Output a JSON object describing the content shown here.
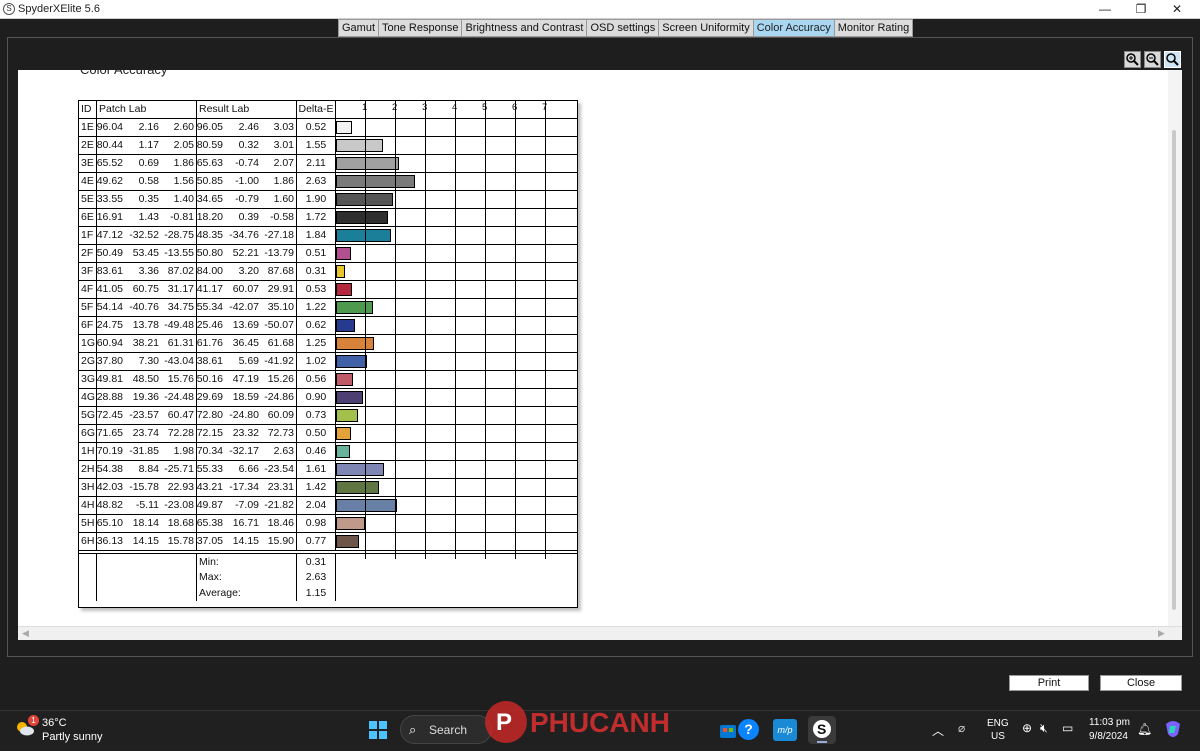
{
  "app": {
    "title": "SpyderXElite 5.6",
    "icon": "spyder-logo-icon",
    "window_controls": {
      "minimize": "—",
      "restore": "❐",
      "close": "✕"
    }
  },
  "tabs": [
    {
      "label": "Gamut",
      "active": false
    },
    {
      "label": "Tone Response",
      "active": false
    },
    {
      "label": "Brightness and Contrast",
      "active": false
    },
    {
      "label": "OSD settings",
      "active": false
    },
    {
      "label": "Screen Uniformity",
      "active": false
    },
    {
      "label": "Color Accuracy",
      "active": true
    },
    {
      "label": "Monitor Rating",
      "active": false
    }
  ],
  "zoom": {
    "zoom_in": "zoom-in-icon",
    "zoom_out": "zoom-out-icon",
    "zoom_fit": "zoom-fit-icon"
  },
  "report": {
    "title": "Color Accuracy",
    "headers": {
      "id": "ID",
      "patch": "Patch Lab",
      "result": "Result Lab",
      "delta": "Delta-E"
    },
    "scale_ticks": [
      "1",
      "2",
      "3",
      "4",
      "5",
      "6",
      "7"
    ],
    "rows": [
      {
        "id": "1E",
        "patch": [
          "96.04",
          "2.16",
          "2.60"
        ],
        "result": [
          "96.05",
          "2.46",
          "3.03"
        ],
        "delta": "0.52",
        "color": "#f2f2f2"
      },
      {
        "id": "2E",
        "patch": [
          "80.44",
          "1.17",
          "2.05"
        ],
        "result": [
          "80.59",
          "0.32",
          "3.01"
        ],
        "delta": "1.55",
        "color": "#c8c8c8"
      },
      {
        "id": "3E",
        "patch": [
          "65.52",
          "0.69",
          "1.86"
        ],
        "result": [
          "65.63",
          "-0.74",
          "2.07"
        ],
        "delta": "2.11",
        "color": "#a0a0a0"
      },
      {
        "id": "4E",
        "patch": [
          "49.62",
          "0.58",
          "1.56"
        ],
        "result": [
          "50.85",
          "-1.00",
          "1.86"
        ],
        "delta": "2.63",
        "color": "#7a7a7a"
      },
      {
        "id": "5E",
        "patch": [
          "33.55",
          "0.35",
          "1.40"
        ],
        "result": [
          "34.65",
          "-0.79",
          "1.60"
        ],
        "delta": "1.90",
        "color": "#555555"
      },
      {
        "id": "6E",
        "patch": [
          "16.91",
          "1.43",
          "-0.81"
        ],
        "result": [
          "18.20",
          "0.39",
          "-0.58"
        ],
        "delta": "1.72",
        "color": "#2e2e2e"
      },
      {
        "id": "1F",
        "patch": [
          "47.12",
          "-32.52",
          "-28.75"
        ],
        "result": [
          "48.35",
          "-34.76",
          "-27.18"
        ],
        "delta": "1.84",
        "color": "#1b7f99"
      },
      {
        "id": "2F",
        "patch": [
          "50.49",
          "53.45",
          "-13.55"
        ],
        "result": [
          "50.80",
          "52.21",
          "-13.79"
        ],
        "delta": "0.51",
        "color": "#b0508f"
      },
      {
        "id": "3F",
        "patch": [
          "83.61",
          "3.36",
          "87.02"
        ],
        "result": [
          "84.00",
          "3.20",
          "87.68"
        ],
        "delta": "0.31",
        "color": "#e8c62a"
      },
      {
        "id": "4F",
        "patch": [
          "41.05",
          "60.75",
          "31.17"
        ],
        "result": [
          "41.17",
          "60.07",
          "29.91"
        ],
        "delta": "0.53",
        "color": "#b3283c"
      },
      {
        "id": "5F",
        "patch": [
          "54.14",
          "-40.76",
          "34.75"
        ],
        "result": [
          "55.34",
          "-42.07",
          "35.10"
        ],
        "delta": "1.22",
        "color": "#4d9a4e"
      },
      {
        "id": "6F",
        "patch": [
          "24.75",
          "13.78",
          "-49.48"
        ],
        "result": [
          "25.46",
          "13.69",
          "-50.07"
        ],
        "delta": "0.62",
        "color": "#263a8f"
      },
      {
        "id": "1G",
        "patch": [
          "60.94",
          "38.21",
          "61.31"
        ],
        "result": [
          "61.76",
          "36.45",
          "61.68"
        ],
        "delta": "1.25",
        "color": "#d9823a"
      },
      {
        "id": "2G",
        "patch": [
          "37.80",
          "7.30",
          "-43.04"
        ],
        "result": [
          "38.61",
          "5.69",
          "-41.92"
        ],
        "delta": "1.02",
        "color": "#4060a8"
      },
      {
        "id": "3G",
        "patch": [
          "49.81",
          "48.50",
          "15.76"
        ],
        "result": [
          "50.16",
          "47.19",
          "15.26"
        ],
        "delta": "0.56",
        "color": "#c05a66"
      },
      {
        "id": "4G",
        "patch": [
          "28.88",
          "19.36",
          "-24.48"
        ],
        "result": [
          "29.69",
          "18.59",
          "-24.86"
        ],
        "delta": "0.90",
        "color": "#4e3f72"
      },
      {
        "id": "5G",
        "patch": [
          "72.45",
          "-23.57",
          "60.47"
        ],
        "result": [
          "72.80",
          "-24.80",
          "60.09"
        ],
        "delta": "0.73",
        "color": "#a3c04a"
      },
      {
        "id": "6G",
        "patch": [
          "71.65",
          "23.74",
          "72.28"
        ],
        "result": [
          "72.15",
          "23.32",
          "72.73"
        ],
        "delta": "0.50",
        "color": "#e3a33a"
      },
      {
        "id": "1H",
        "patch": [
          "70.19",
          "-31.85",
          "1.98"
        ],
        "result": [
          "70.34",
          "-32.17",
          "2.63"
        ],
        "delta": "0.46",
        "color": "#66b29b"
      },
      {
        "id": "2H",
        "patch": [
          "54.38",
          "8.84",
          "-25.71"
        ],
        "result": [
          "55.33",
          "6.66",
          "-23.54"
        ],
        "delta": "1.61",
        "color": "#7f86b4"
      },
      {
        "id": "3H",
        "patch": [
          "42.03",
          "-15.78",
          "22.93"
        ],
        "result": [
          "43.21",
          "-17.34",
          "23.31"
        ],
        "delta": "1.42",
        "color": "#5f7542"
      },
      {
        "id": "4H",
        "patch": [
          "48.82",
          "-5.11",
          "-23.08"
        ],
        "result": [
          "49.87",
          "-7.09",
          "-21.82"
        ],
        "delta": "2.04",
        "color": "#6880a6"
      },
      {
        "id": "5H",
        "patch": [
          "65.10",
          "18.14",
          "18.68"
        ],
        "result": [
          "65.38",
          "16.71",
          "18.46"
        ],
        "delta": "0.98",
        "color": "#c0998a"
      },
      {
        "id": "6H",
        "patch": [
          "36.13",
          "14.15",
          "15.78"
        ],
        "result": [
          "37.05",
          "14.15",
          "15.90"
        ],
        "delta": "0.77",
        "color": "#6e5549"
      }
    ],
    "summary": [
      {
        "label": "Min:",
        "value": "0.31"
      },
      {
        "label": "Max:",
        "value": "2.63"
      },
      {
        "label": "Average:",
        "value": "1.15"
      }
    ]
  },
  "buttons": {
    "print": "Print",
    "close": "Close"
  },
  "taskbar": {
    "weather_temp": "36°C",
    "weather_desc": "Partly sunny",
    "weather_badge": "1",
    "search_label": "Search",
    "lang_line1": "ENG",
    "lang_line2": "US",
    "time": "11:03 pm",
    "date": "9/8/2024"
  },
  "watermark": {
    "brand": "PHUCANH"
  }
}
